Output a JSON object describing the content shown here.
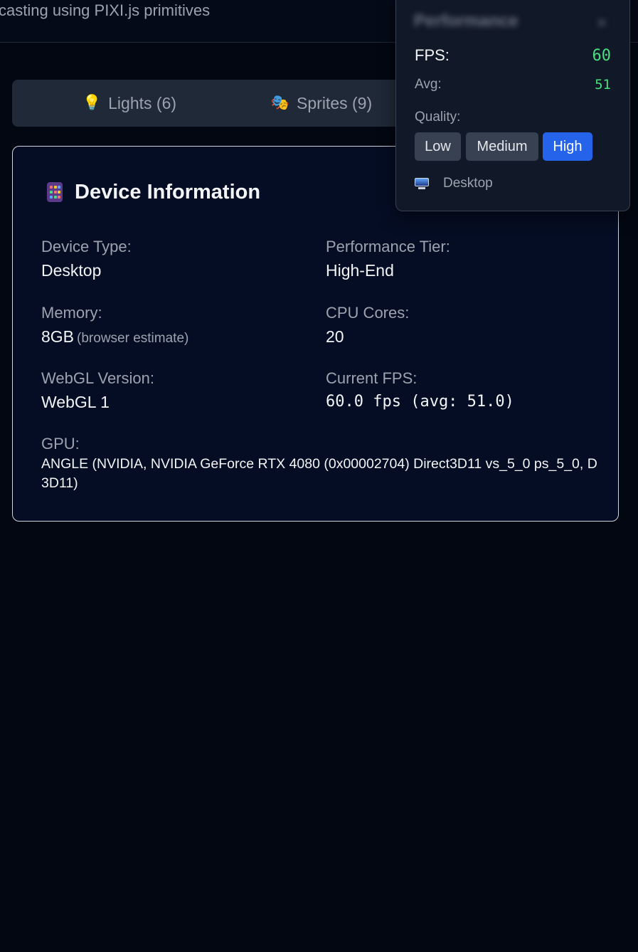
{
  "header": {
    "subtitle": "casting using PIXI.js primitives"
  },
  "tabs": [
    {
      "icon": "💡",
      "label": "Lights (6)"
    },
    {
      "icon": "🎭",
      "label": "Sprites (9)"
    },
    {
      "icon": "",
      "label": ""
    }
  ],
  "device_info": {
    "title": "Device Information",
    "icon": "abacus-icon",
    "fields": {
      "device_type": {
        "label": "Device Type:",
        "value": "Desktop"
      },
      "performance_tier": {
        "label": "Performance Tier:",
        "value": "High-End"
      },
      "memory": {
        "label": "Memory:",
        "value": "8GB",
        "note": "(browser estimate)"
      },
      "cpu_cores": {
        "label": "CPU Cores:",
        "value": "20"
      },
      "webgl_version": {
        "label": "WebGL Version:",
        "value": "WebGL 1"
      },
      "current_fps": {
        "label": "Current FPS:",
        "value": "60.0 fps (avg: 51.0)"
      },
      "gpu": {
        "label": "GPU:",
        "value": "ANGLE (NVIDIA, NVIDIA GeForce RTX 4080 (0x00002704) Direct3D11 vs_5_0 ps_5_0, D3D11)"
      }
    }
  },
  "performance_panel": {
    "title": "Performance",
    "close_glyph": "×",
    "fps_label": "FPS:",
    "fps_value": "60",
    "avg_label": "Avg:",
    "avg_value": "51",
    "quality_label": "Quality:",
    "quality_options": [
      "Low",
      "Medium",
      "High"
    ],
    "quality_selected": "High",
    "device_icon": "desktop-computer-icon",
    "device_label": "Desktop"
  },
  "colors": {
    "background": "#030712",
    "card_background": "#050d24",
    "accent": "#2563eb",
    "fps_green": "#4ade80"
  }
}
